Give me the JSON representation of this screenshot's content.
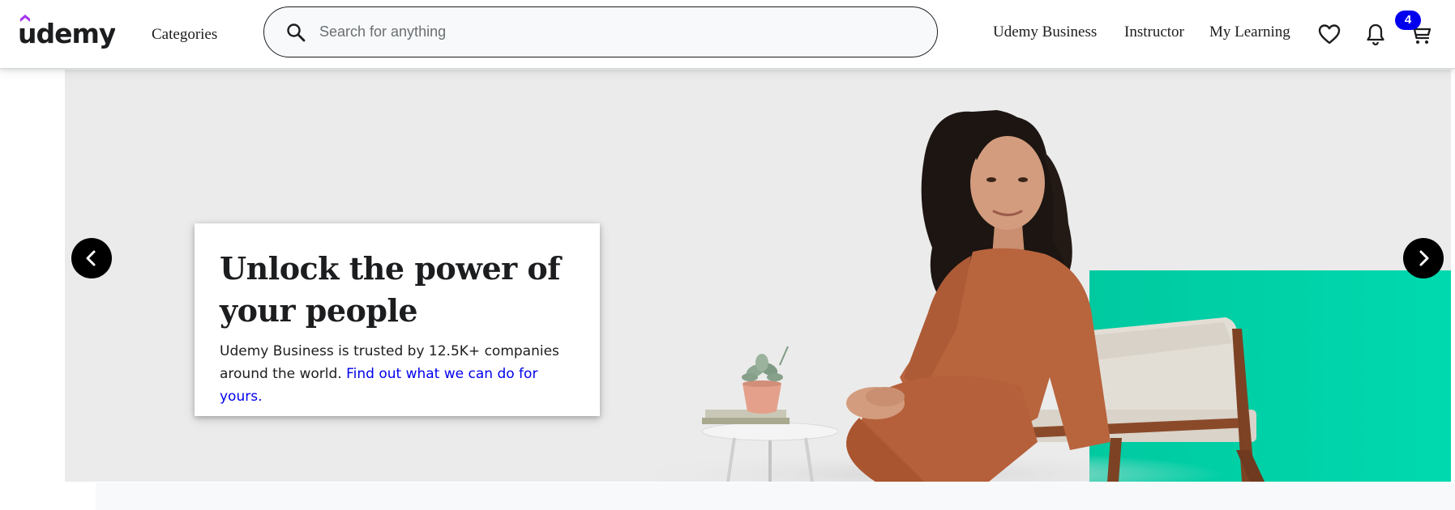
{
  "header": {
    "logo_text": "udemy",
    "categories_label": "Categories",
    "search": {
      "placeholder": "Search for anything",
      "value": ""
    },
    "nav": {
      "business": "Udemy Business",
      "instructor": "Instructor",
      "my_learning": "My Learning"
    },
    "icons": {
      "search": "search-icon",
      "wishlist": "heart-icon",
      "notifications": "bell-icon",
      "cart": "cart-icon"
    },
    "cart_count": "4"
  },
  "hero": {
    "title": "Unlock the power of your people",
    "body": "Udemy Business is trusted by 12.5K+ companies around the world.",
    "link": "Find out what we can do for yours.",
    "prev_icon": "chevron-left-icon",
    "next_icon": "chevron-right-icon"
  },
  "colors": {
    "brand_purple": "#a435f0",
    "text_dark": "#1c1d1f",
    "link_blue": "#0000ee",
    "badge_blue": "#0000ee",
    "hero_bg": "#ebebeb",
    "hero_teal": "#00d1a7"
  }
}
